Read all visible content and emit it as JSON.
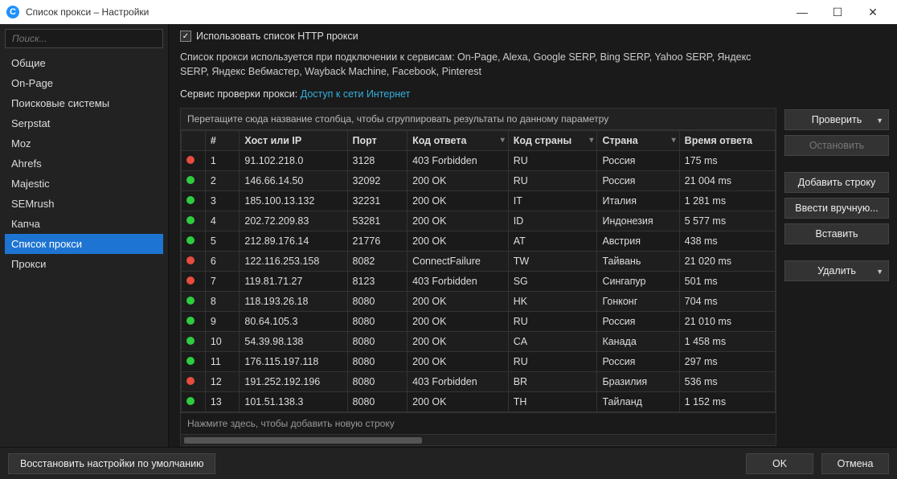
{
  "window": {
    "title": "Список прокси – Настройки",
    "logo_letter": "C"
  },
  "sidebar": {
    "search_placeholder": "Поиск...",
    "items": [
      {
        "label": "Общие"
      },
      {
        "label": "On-Page"
      },
      {
        "label": "Поисковые системы"
      },
      {
        "label": "Serpstat"
      },
      {
        "label": "Moz"
      },
      {
        "label": "Ahrefs"
      },
      {
        "label": "Majestic"
      },
      {
        "label": "SEMrush"
      },
      {
        "label": "Капча"
      },
      {
        "label": "Список прокси",
        "selected": true
      },
      {
        "label": "Прокси"
      }
    ]
  },
  "checkbox": {
    "checked": true,
    "label": "Использовать список HTTP прокси"
  },
  "description": "Список прокси используется при подключении к сервисам: On-Page, Alexa, Google SERP, Bing SERP, Yahoo SERP, Яндекс SERP, Яндекс Вебмастер, Wayback Machine, Facebook, Pinterest",
  "service_label": "Сервис проверки прокси: ",
  "service_link": "Доступ к сети Интернет",
  "group_hint": "Перетащите сюда название столбца, чтобы сгруппировать результаты по данному параметру",
  "columns": {
    "num": "#",
    "host": "Хост или IP",
    "port": "Порт",
    "code": "Код ответа",
    "cc": "Код страны",
    "cn": "Страна",
    "rt": "Время ответа"
  },
  "rows": [
    {
      "status": "red",
      "n": 1,
      "host": "91.102.218.0",
      "port": "3128",
      "code": "403 Forbidden",
      "cc": "RU",
      "cn": "Россия",
      "rt": "175 ms"
    },
    {
      "status": "green",
      "n": 2,
      "host": "146.66.14.50",
      "port": "32092",
      "code": "200 OK",
      "cc": "RU",
      "cn": "Россия",
      "rt": "21 004 ms"
    },
    {
      "status": "green",
      "n": 3,
      "host": "185.100.13.132",
      "port": "32231",
      "code": "200 OK",
      "cc": "IT",
      "cn": "Италия",
      "rt": "1 281 ms"
    },
    {
      "status": "green",
      "n": 4,
      "host": "202.72.209.83",
      "port": "53281",
      "code": "200 OK",
      "cc": "ID",
      "cn": "Индонезия",
      "rt": "5 577 ms"
    },
    {
      "status": "green",
      "n": 5,
      "host": "212.89.176.14",
      "port": "21776",
      "code": "200 OK",
      "cc": "AT",
      "cn": "Австрия",
      "rt": "438 ms"
    },
    {
      "status": "red",
      "n": 6,
      "host": "122.116.253.158",
      "port": "8082",
      "code": "ConnectFailure",
      "cc": "TW",
      "cn": "Тайвань",
      "rt": "21 020 ms"
    },
    {
      "status": "red",
      "n": 7,
      "host": "119.81.71.27",
      "port": "8123",
      "code": "403 Forbidden",
      "cc": "SG",
      "cn": "Сингапур",
      "rt": "501 ms"
    },
    {
      "status": "green",
      "n": 8,
      "host": "118.193.26.18",
      "port": "8080",
      "code": "200 OK",
      "cc": "HK",
      "cn": "Гонконг",
      "rt": "704 ms"
    },
    {
      "status": "green",
      "n": 9,
      "host": "80.64.105.3",
      "port": "8080",
      "code": "200 OK",
      "cc": "RU",
      "cn": "Россия",
      "rt": "21 010 ms"
    },
    {
      "status": "green",
      "n": 10,
      "host": "54.39.98.138",
      "port": "8080",
      "code": "200 OK",
      "cc": "CA",
      "cn": "Канада",
      "rt": "1 458 ms"
    },
    {
      "status": "green",
      "n": 11,
      "host": "176.115.197.118",
      "port": "8080",
      "code": "200 OK",
      "cc": "RU",
      "cn": "Россия",
      "rt": "297 ms"
    },
    {
      "status": "red",
      "n": 12,
      "host": "191.252.192.196",
      "port": "8080",
      "code": "403 Forbidden",
      "cc": "BR",
      "cn": "Бразилия",
      "rt": "536 ms"
    },
    {
      "status": "green",
      "n": 13,
      "host": "101.51.138.3",
      "port": "8080",
      "code": "200 OK",
      "cc": "TH",
      "cn": "Тайланд",
      "rt": "1 152 ms"
    }
  ],
  "add_row_hint": "Нажмите здесь, чтобы добавить новую строку",
  "actions": {
    "check": "Проверить",
    "stop": "Остановить",
    "add": "Добавить строку",
    "manual": "Ввести вручную...",
    "paste": "Вставить",
    "delete": "Удалить"
  },
  "footer": {
    "restore": "Восстановить настройки по умолчанию",
    "ok": "OK",
    "cancel": "Отмена"
  }
}
